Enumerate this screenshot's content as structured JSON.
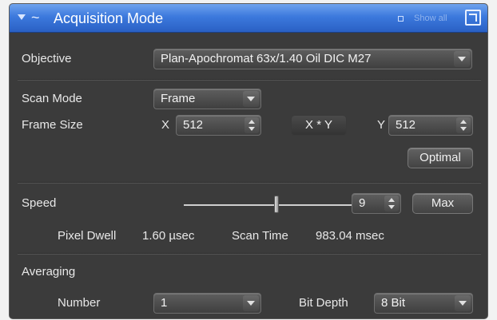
{
  "header": {
    "title": "Acquisition Mode",
    "show_all": "Show all",
    "accent": "#3c79dd"
  },
  "objective": {
    "label": "Objective",
    "value": "Plan-Apochromat 63x/1.40 Oil DIC M27"
  },
  "scan_mode": {
    "label": "Scan Mode",
    "value": "Frame"
  },
  "frame_size": {
    "label": "Frame Size",
    "x_label": "X",
    "x_value": "512",
    "xy_button": "X * Y",
    "y_label": "Y",
    "y_value": "512",
    "optimal_button": "Optimal"
  },
  "speed": {
    "label": "Speed",
    "value": "9",
    "slider_fraction": 0.55,
    "max_button": "Max"
  },
  "timing": {
    "pixel_dwell_label": "Pixel Dwell",
    "pixel_dwell_value": "1.60 µsec",
    "scan_time_label": "Scan Time",
    "scan_time_value": "983.04 msec"
  },
  "averaging": {
    "label": "Averaging",
    "number_label": "Number",
    "number_value": "1",
    "bit_depth_label": "Bit Depth",
    "bit_depth_value": "8 Bit"
  }
}
